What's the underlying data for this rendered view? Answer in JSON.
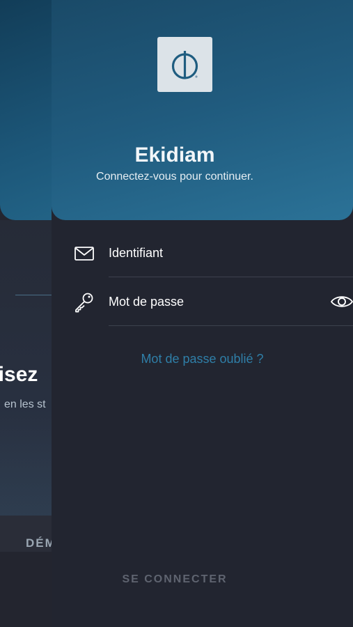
{
  "colors": {
    "accent": "#2f7fa8",
    "header_gradient_start": "#1a4a68",
    "header_gradient_end": "#2b7297",
    "background": "#222530",
    "disabled_text": "#5f6470"
  },
  "background_screen": {
    "heading_fragment": "risez",
    "subtext_fragment": "en les st",
    "bottom_button_fragment": "DÉM"
  },
  "header": {
    "logo_icon": "ekidiam-logo-icon",
    "title": "Ekidiam",
    "subtitle": "Connectez-vous pour continuer."
  },
  "form": {
    "identifier": {
      "icon": "mail-icon",
      "placeholder": "Identifiant",
      "value": ""
    },
    "password": {
      "icon": "key-icon",
      "placeholder": "Mot de passe",
      "value": "",
      "toggle_icon": "eye-icon"
    },
    "forgot_password": "Mot de passe oublié ?",
    "submit_label": "SE CONNECTER"
  }
}
